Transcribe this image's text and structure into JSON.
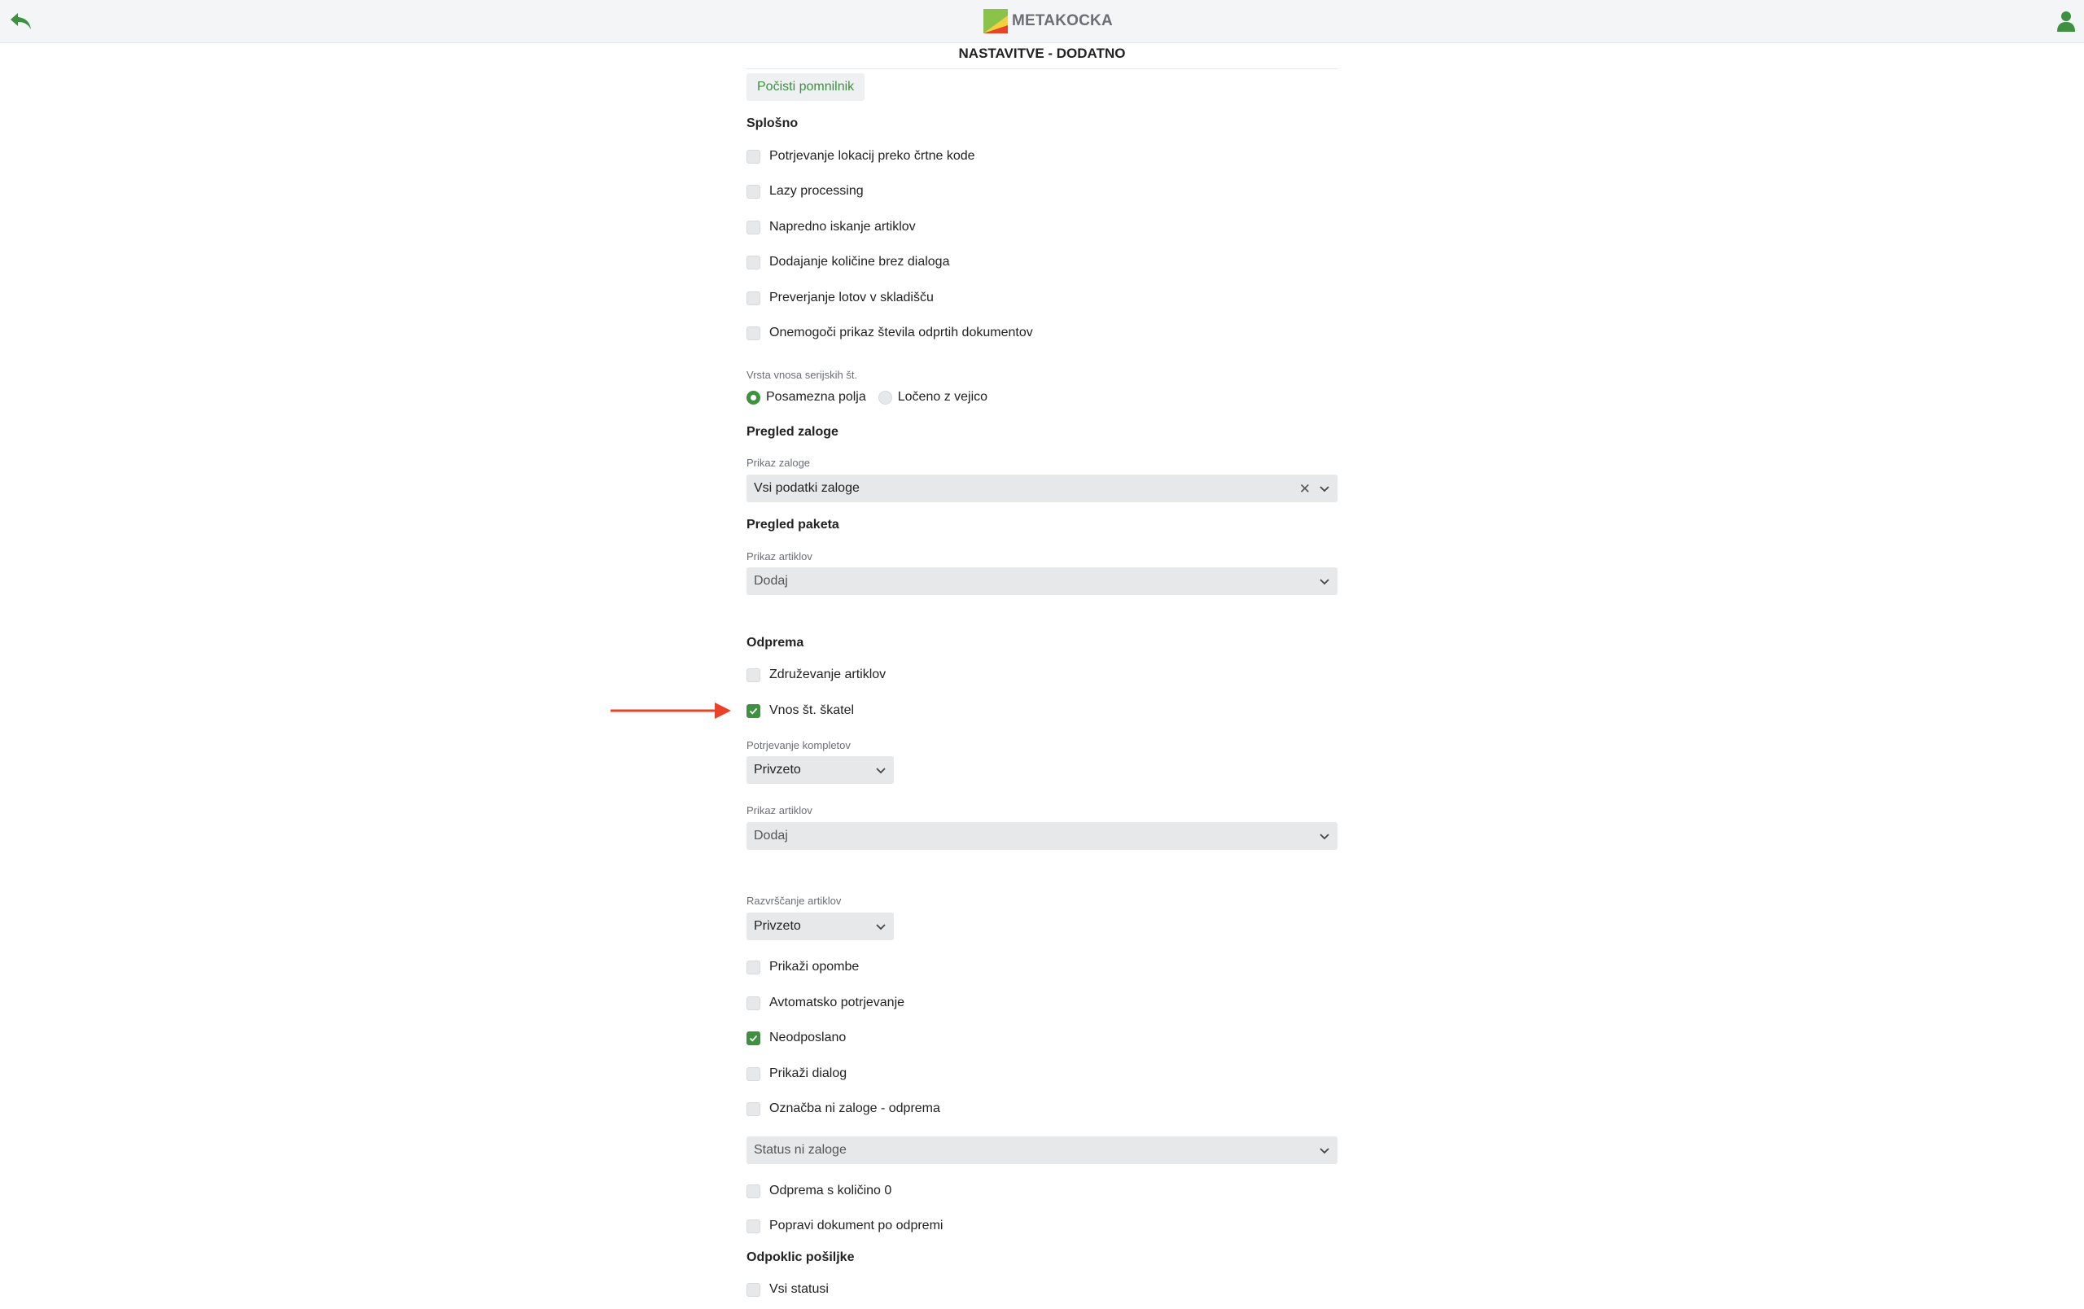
{
  "header": {
    "brand": "METAKOCKA"
  },
  "page": {
    "title": "NASTAVITVE - DODATNO",
    "clear_label": "Počisti pomnilnik"
  },
  "colors": {
    "accent": "#3d9140",
    "annotation_arrow": "#e8432a",
    "input_bg": "#e7e8ea"
  },
  "general": {
    "heading": "Splošno",
    "options": [
      {
        "label": "Potrjevanje lokacij preko črtne kode",
        "checked": false
      },
      {
        "label": "Lazy processing",
        "checked": false
      },
      {
        "label": "Napredno iskanje artiklov",
        "checked": false
      },
      {
        "label": "Dodajanje količine brez dialoga",
        "checked": false
      },
      {
        "label": "Preverjanje lotov v skladišču",
        "checked": false
      },
      {
        "label": "Onemogoči prikaz števila odprtih dokumentov",
        "checked": false
      }
    ],
    "serial_input": {
      "label": "Vrsta vnosa serijskih št.",
      "options": [
        {
          "label": "Posamezna polja",
          "selected": true
        },
        {
          "label": "Ločeno z vejico",
          "selected": false
        }
      ]
    }
  },
  "stock_view": {
    "heading": "Pregled zaloge",
    "display_label": "Prikaz zaloge",
    "display_value": "Vsi podatki zaloge"
  },
  "package_view": {
    "heading": "Pregled paketa",
    "articles_label": "Prikaz artiklov",
    "articles_value": "Dodaj"
  },
  "shipping": {
    "heading": "Odprema",
    "merge_articles": {
      "label": "Združevanje artiklov",
      "checked": false
    },
    "box_count": {
      "label": "Vnos št. škatel",
      "checked": true
    },
    "sets_label": "Potrjevanje kompletov",
    "sets_value": "Privzeto",
    "articles_label": "Prikaz artiklov",
    "articles_value": "Dodaj",
    "sort_label": "Razvrščanje artiklov",
    "sort_value": "Privzeto",
    "options": [
      {
        "label": "Prikaži opombe",
        "checked": false
      },
      {
        "label": "Avtomatsko potrjevanje",
        "checked": false
      },
      {
        "label": "Neodposlano",
        "checked": true
      },
      {
        "label": "Prikaži dialog",
        "checked": false
      },
      {
        "label": "Označba ni zaloge - odprema",
        "checked": false
      }
    ],
    "no_stock_status": "Status ni zaloge",
    "options2": [
      {
        "label": "Odprema s količino 0",
        "checked": false
      },
      {
        "label": "Popravi dokument po odpremi",
        "checked": false
      }
    ]
  },
  "recall": {
    "heading": "Odpoklic pošiljke",
    "all_statuses": {
      "label": "Vsi statusi",
      "checked": false
    }
  }
}
